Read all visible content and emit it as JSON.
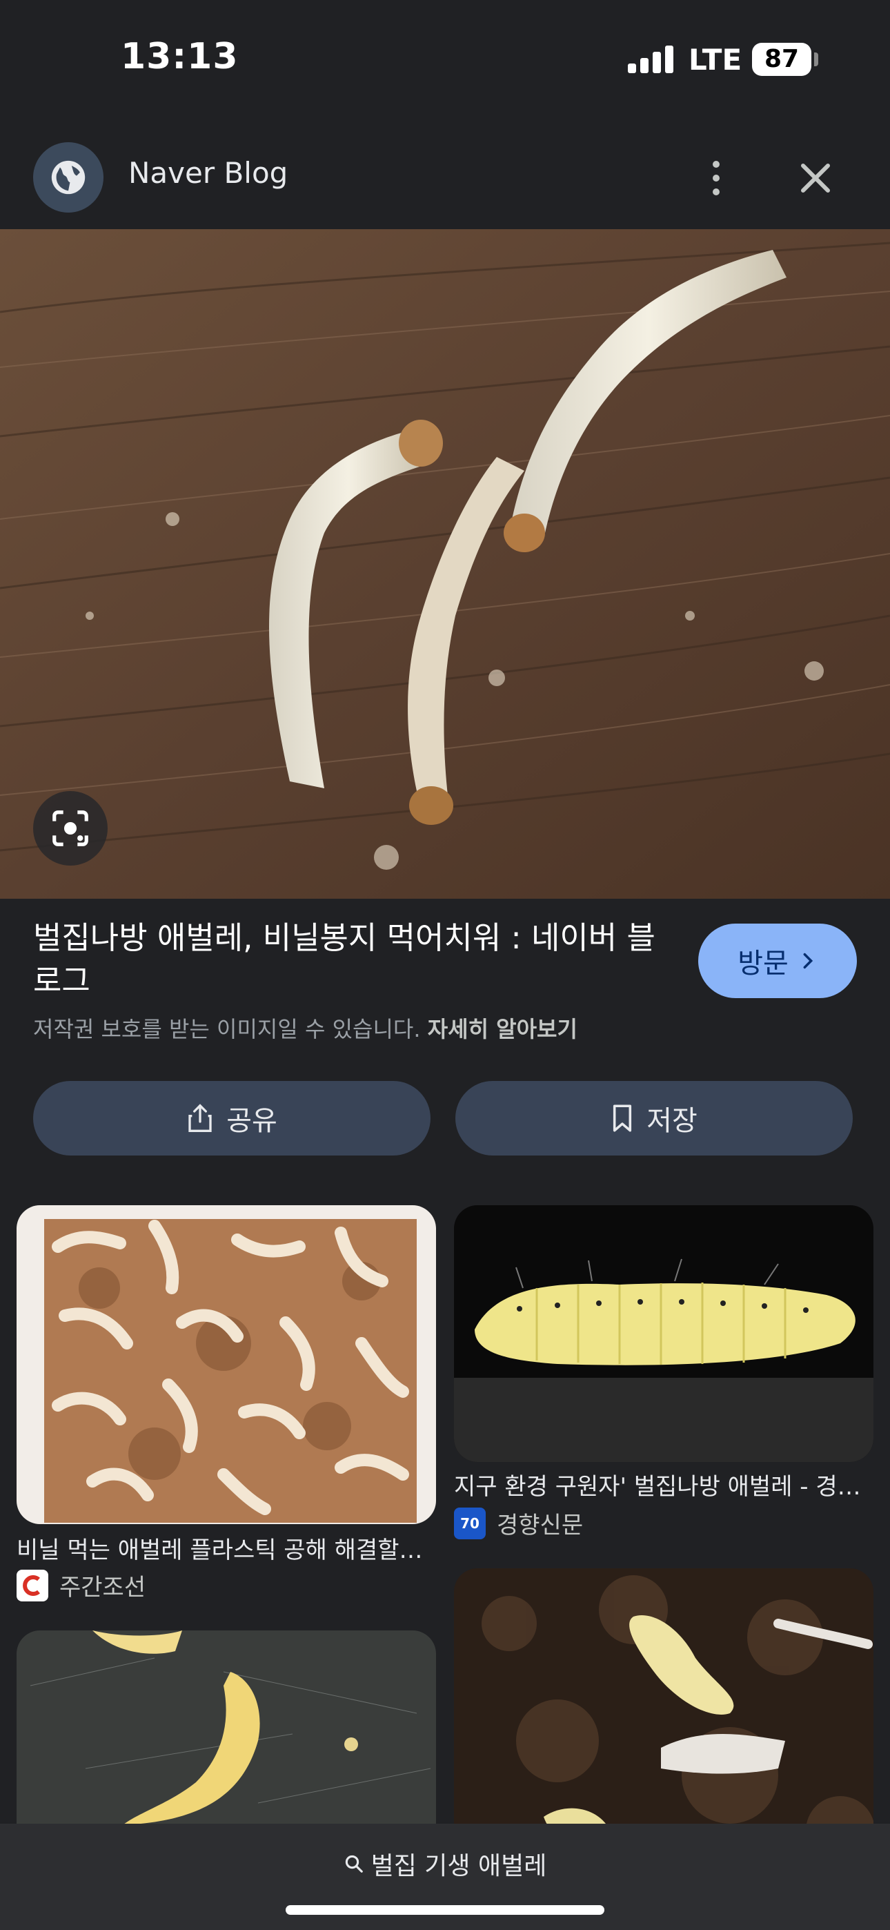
{
  "status_bar": {
    "time": "13:13",
    "network": "LTE",
    "battery": "87"
  },
  "source": {
    "name": "Naver Blog",
    "icon": "globe-icon"
  },
  "result": {
    "title": "벌집나방 애벌레, 비닐봉지 먹어치워 : 네이버 블로그",
    "visit_label": "방문",
    "copyright_text": "저작권 보호를 받는 이미지일 수 있습니다.",
    "learn_more": "자세히 알아보기"
  },
  "actions": {
    "share_label": "공유",
    "save_label": "저장"
  },
  "related": [
    {
      "title": "비닐 먹는 애벌레 플라스틱 공해 해결할…",
      "source": "주간조선",
      "logo_color": "#d93025"
    },
    {
      "title": "지구 환경 구원자' 벌집나방 애벌레 - 경…",
      "source": "경향신문",
      "logo_color": "#1a56c8"
    }
  ],
  "search": {
    "query": "벌집 기생 애벌레"
  }
}
